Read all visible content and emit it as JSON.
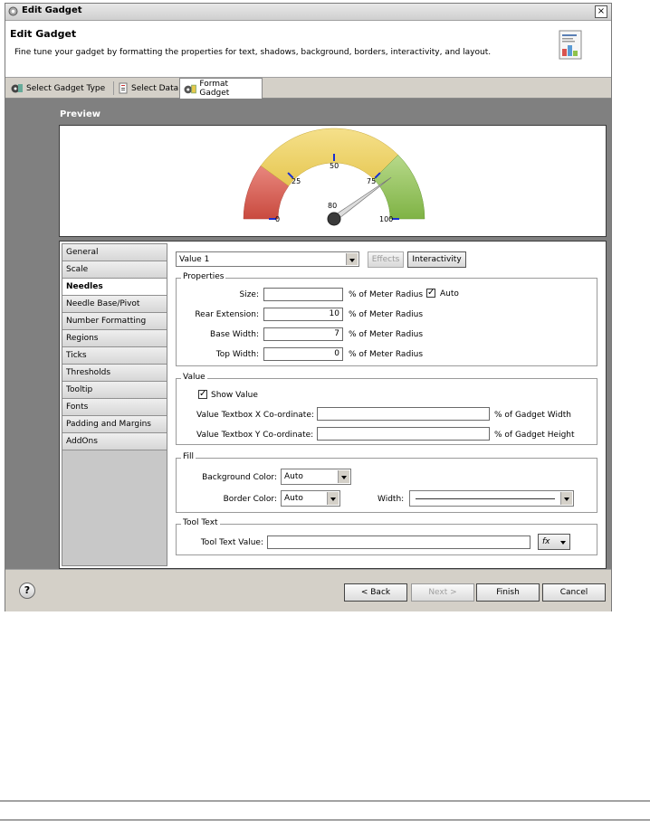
{
  "window": {
    "title": "Edit Gadget",
    "close_label": "×"
  },
  "header": {
    "title": "Edit Gadget",
    "description": "Fine tune your gadget by formatting the properties for text, shadows, background, borders, interactivity, and layout."
  },
  "tabs": [
    {
      "label": "Select Gadget Type",
      "icon": "gadget-type-icon"
    },
    {
      "label": "Select Data",
      "icon": "data-icon"
    },
    {
      "label": "Format Gadget",
      "icon": "format-icon",
      "selected": true
    }
  ],
  "preview": {
    "label": "Preview",
    "gauge": {
      "ticks": [
        "0",
        "25",
        "50",
        "75",
        "100"
      ],
      "value_label": "80",
      "value": 80,
      "min": 0,
      "max": 100,
      "colors": {
        "low": "#d9534f",
        "mid": "#e8c84a",
        "high": "#8fc24a"
      }
    }
  },
  "nav": {
    "items": [
      "General",
      "Scale",
      "Needles",
      "Needle Base/Pivot",
      "Number Formatting",
      "Regions",
      "Ticks",
      "Thresholds",
      "Tooltip",
      "Fonts",
      "Padding and Margins",
      "AddOns"
    ],
    "selected": "Needles"
  },
  "needles": {
    "selector_value": "Value 1",
    "effects_label": "Effects",
    "interactivity_label": "Interactivity",
    "properties": {
      "legend": "Properties",
      "size_label": "Size:",
      "size_value": "",
      "size_unit": "% of Meter Radius",
      "auto_label": "Auto",
      "auto_checked": true,
      "rear_label": "Rear Extension:",
      "rear_value": "10",
      "rear_unit": "% of Meter Radius",
      "base_label": "Base Width:",
      "base_value": "7",
      "base_unit": "% of Meter Radius",
      "top_label": "Top Width:",
      "top_value": "0",
      "top_unit": "% of Meter Radius"
    },
    "value": {
      "legend": "Value",
      "show_value_label": "Show Value",
      "show_value_checked": true,
      "x_label": "Value Textbox X Co-ordinate:",
      "x_value": "",
      "x_unit": "% of Gadget Width",
      "y_label": "Value Textbox Y Co-ordinate:",
      "y_value": "",
      "y_unit": "% of Gadget Height"
    },
    "fill": {
      "legend": "Fill",
      "bg_label": "Background Color:",
      "bg_value": "Auto",
      "border_label": "Border Color:",
      "border_value": "Auto",
      "width_label": "Width:"
    },
    "tooltext": {
      "legend": "Tool Text",
      "label": "Tool Text Value:",
      "value": "",
      "fx_label": "fx"
    }
  },
  "footer": {
    "help": "?",
    "back": "< Back",
    "next": "Next >",
    "finish": "Finish",
    "cancel": "Cancel"
  }
}
